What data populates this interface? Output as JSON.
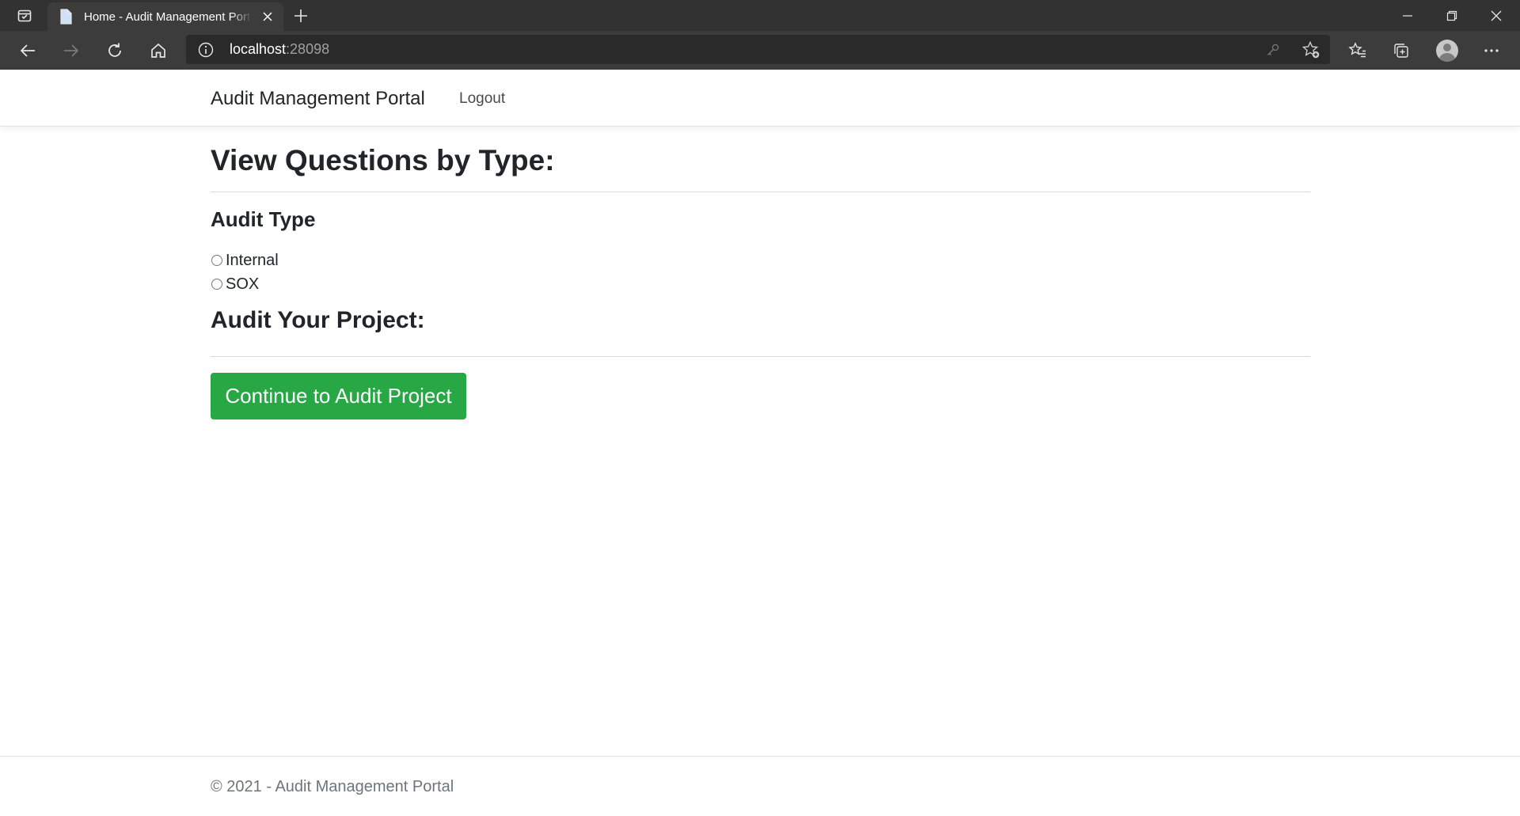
{
  "browser": {
    "tab_title": "Home - Audit Management Portal",
    "url_host": "localhost",
    "url_port": ":28098"
  },
  "navbar": {
    "brand": "Audit Management Portal",
    "logout_label": "Logout"
  },
  "main": {
    "view_questions_heading": "View Questions by Type:",
    "audit_type_heading": "Audit Type",
    "audit_type_options": [
      {
        "label": "Internal",
        "selected": false
      },
      {
        "label": "SOX",
        "selected": false
      }
    ],
    "audit_project_heading": "Audit Your Project:",
    "continue_button_label": "Continue to Audit Project"
  },
  "footer": {
    "text": "© 2021 - Audit Management Portal"
  },
  "colors": {
    "chrome_dark": "#323232",
    "chrome_toolbar": "#3c3c3c",
    "success_button": "#28a745",
    "footer_text": "#6c757d"
  },
  "icons": {
    "tab_actions": "tab-actions-icon",
    "favicon": "page-icon",
    "tab_close": "close-icon",
    "new_tab": "plus-icon",
    "minimize": "minimize-icon",
    "restore": "restore-icon",
    "window_close": "close-icon",
    "back": "back-arrow-icon",
    "forward": "forward-arrow-icon",
    "refresh": "refresh-icon",
    "home": "home-icon",
    "site_info": "info-icon",
    "password": "key-icon",
    "add_favorite": "star-add-icon",
    "favorites": "favorites-icon",
    "collections": "collections-icon",
    "profile": "profile-avatar-icon",
    "menu": "more-icon"
  }
}
